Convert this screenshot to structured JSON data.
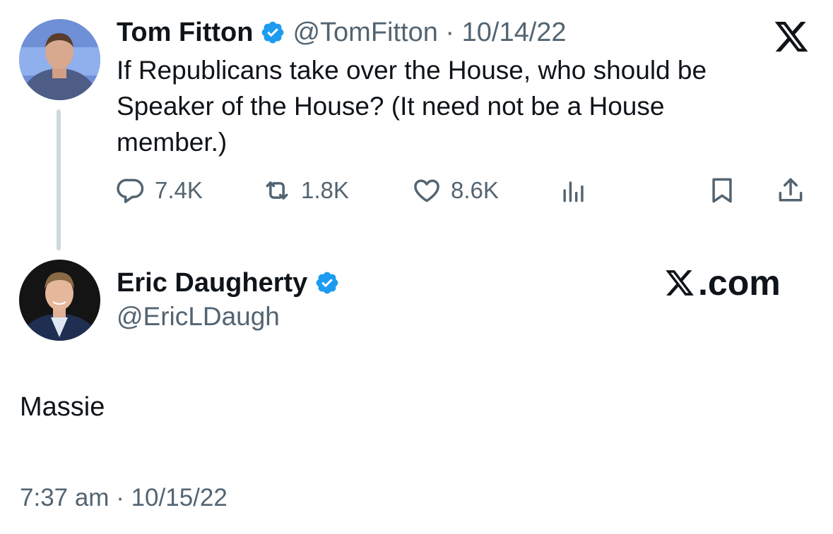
{
  "parent_tweet": {
    "author_name": "Tom Fitton",
    "handle_and_date": "@TomFitton · 10/14/22",
    "text": "If Republicans take over the House, who should be Speaker of the House? (It need not be a House member.)",
    "stats": {
      "replies": "7.4K",
      "retweets": "1.8K",
      "likes": "8.6K"
    }
  },
  "reply_tweet": {
    "author_name": "Eric Daugherty",
    "handle": "@EricLDaugh",
    "brand": ".com",
    "text": "Massie",
    "timestamp": "7:37 am · 10/15/22"
  },
  "colors": {
    "verified_badge": "#1d9bf0",
    "muted_text": "#536471",
    "primary_text": "#0f1419",
    "thread_line": "#cfd9de"
  },
  "icons": [
    "x-logo-icon",
    "verified-badge-icon",
    "reply-icon",
    "retweet-icon",
    "like-icon",
    "views-icon",
    "bookmark-icon",
    "share-icon"
  ]
}
